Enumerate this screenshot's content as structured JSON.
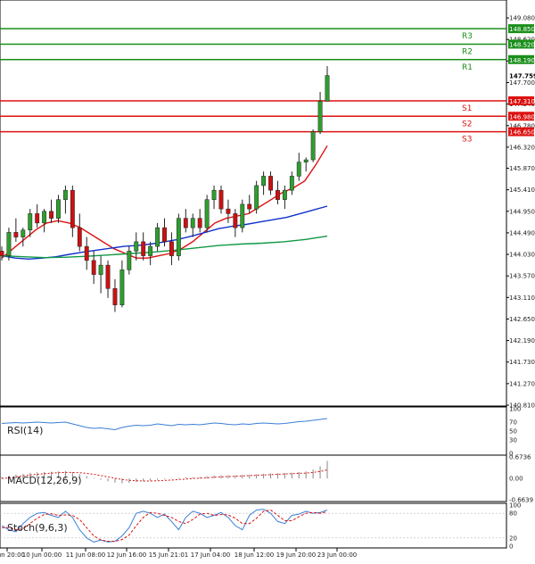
{
  "chart_data": [
    {
      "type": "candlestick",
      "title": "",
      "y_ticks": [
        "149.080",
        "148.620",
        "148.160",
        "147.700",
        "147.240",
        "146.780",
        "146.320",
        "145.870",
        "145.410",
        "144.950",
        "144.490",
        "144.030",
        "143.570",
        "143.110",
        "142.650",
        "142.190",
        "141.730",
        "141.270",
        "140.810"
      ],
      "ylim": [
        140.81,
        149.31
      ],
      "x_ticks": [
        "9 Jun 20:00",
        "10 Jun 00:00",
        "11 Jun 08:00",
        "12 Jun 16:00",
        "15 Jun 21:01",
        "17 Jun 04:00",
        "18 Jun 12:00",
        "19 Jun 20:00",
        "23 Jun 00:00"
      ],
      "candles": [
        {
          "o": 144.1,
          "h": 144.2,
          "l": 143.9,
          "c": 144.0
        },
        {
          "o": 144.0,
          "h": 144.6,
          "l": 143.9,
          "c": 144.5
        },
        {
          "o": 144.5,
          "h": 144.8,
          "l": 144.3,
          "c": 144.4
        },
        {
          "o": 144.4,
          "h": 144.6,
          "l": 144.2,
          "c": 144.55
        },
        {
          "o": 144.55,
          "h": 145.0,
          "l": 144.4,
          "c": 144.9
        },
        {
          "o": 144.9,
          "h": 145.1,
          "l": 144.6,
          "c": 144.7
        },
        {
          "o": 144.7,
          "h": 145.0,
          "l": 144.5,
          "c": 144.95
        },
        {
          "o": 144.95,
          "h": 145.2,
          "l": 144.7,
          "c": 144.8
        },
        {
          "o": 144.8,
          "h": 145.3,
          "l": 144.7,
          "c": 145.2
        },
        {
          "o": 145.2,
          "h": 145.5,
          "l": 144.9,
          "c": 145.4
        },
        {
          "o": 145.4,
          "h": 145.5,
          "l": 144.4,
          "c": 144.6
        },
        {
          "o": 144.6,
          "h": 144.9,
          "l": 144.1,
          "c": 144.2
        },
        {
          "o": 144.2,
          "h": 144.4,
          "l": 143.7,
          "c": 143.9
        },
        {
          "o": 143.9,
          "h": 144.1,
          "l": 143.4,
          "c": 143.6
        },
        {
          "o": 143.6,
          "h": 144.0,
          "l": 143.2,
          "c": 143.8
        },
        {
          "o": 143.8,
          "h": 143.9,
          "l": 143.1,
          "c": 143.3
        },
        {
          "o": 143.3,
          "h": 143.5,
          "l": 142.8,
          "c": 142.95
        },
        {
          "o": 142.95,
          "h": 143.9,
          "l": 142.9,
          "c": 143.7
        },
        {
          "o": 143.7,
          "h": 144.2,
          "l": 143.6,
          "c": 144.1
        },
        {
          "o": 144.1,
          "h": 144.5,
          "l": 143.9,
          "c": 144.3
        },
        {
          "o": 144.3,
          "h": 144.5,
          "l": 143.9,
          "c": 144.0
        },
        {
          "o": 144.0,
          "h": 144.3,
          "l": 143.8,
          "c": 144.2
        },
        {
          "o": 144.2,
          "h": 144.7,
          "l": 144.1,
          "c": 144.6
        },
        {
          "o": 144.6,
          "h": 144.8,
          "l": 144.2,
          "c": 144.3
        },
        {
          "o": 144.3,
          "h": 144.5,
          "l": 143.8,
          "c": 144.0
        },
        {
          "o": 144.0,
          "h": 144.9,
          "l": 143.9,
          "c": 144.8
        },
        {
          "o": 144.8,
          "h": 145.0,
          "l": 144.5,
          "c": 144.6
        },
        {
          "o": 144.6,
          "h": 144.9,
          "l": 144.4,
          "c": 144.8
        },
        {
          "o": 144.8,
          "h": 145.0,
          "l": 144.5,
          "c": 144.6
        },
        {
          "o": 144.6,
          "h": 145.3,
          "l": 144.5,
          "c": 145.2
        },
        {
          "o": 145.2,
          "h": 145.5,
          "l": 145.0,
          "c": 145.4
        },
        {
          "o": 145.4,
          "h": 145.5,
          "l": 144.9,
          "c": 145.0
        },
        {
          "o": 145.0,
          "h": 145.2,
          "l": 144.7,
          "c": 144.9
        },
        {
          "o": 144.9,
          "h": 145.0,
          "l": 144.4,
          "c": 144.6
        },
        {
          "o": 144.6,
          "h": 145.2,
          "l": 144.5,
          "c": 145.1
        },
        {
          "o": 145.1,
          "h": 145.3,
          "l": 144.9,
          "c": 145.0
        },
        {
          "o": 145.0,
          "h": 145.6,
          "l": 144.9,
          "c": 145.5
        },
        {
          "o": 145.5,
          "h": 145.8,
          "l": 145.3,
          "c": 145.7
        },
        {
          "o": 145.7,
          "h": 145.8,
          "l": 145.3,
          "c": 145.4
        },
        {
          "o": 145.4,
          "h": 145.6,
          "l": 145.1,
          "c": 145.2
        },
        {
          "o": 145.2,
          "h": 145.5,
          "l": 145.0,
          "c": 145.4
        },
        {
          "o": 145.4,
          "h": 145.8,
          "l": 145.3,
          "c": 145.7
        },
        {
          "o": 145.7,
          "h": 146.2,
          "l": 145.6,
          "c": 146.0
        },
        {
          "o": 146.0,
          "h": 146.1,
          "l": 145.8,
          "c": 146.05
        },
        {
          "o": 146.05,
          "h": 146.7,
          "l": 146.0,
          "c": 146.65
        },
        {
          "o": 146.65,
          "h": 147.5,
          "l": 146.6,
          "c": 147.3
        },
        {
          "o": 147.3,
          "h": 148.05,
          "l": 147.3,
          "c": 147.85
        }
      ],
      "moving_averages": [
        {
          "color": "#dd1111",
          "values": [
            143.95,
            144.15,
            144.35,
            144.55,
            144.7,
            144.75,
            144.7,
            144.6,
            144.45,
            144.3,
            144.15,
            144.05,
            143.95,
            143.95,
            144.0,
            144.05,
            144.15,
            144.3,
            144.5,
            144.7,
            144.8,
            144.85,
            144.9,
            145.05,
            145.2,
            145.35,
            145.45,
            145.6,
            145.95,
            146.35
          ]
        },
        {
          "color": "#1133cc",
          "values": [
            144.0,
            143.95,
            143.93,
            143.95,
            143.98,
            144.03,
            144.08,
            144.12,
            144.16,
            144.2,
            144.22,
            144.25,
            144.3,
            144.35,
            144.42,
            144.5,
            144.58,
            144.63,
            144.67,
            144.72,
            144.77,
            144.82,
            144.9,
            144.98,
            145.06
          ]
        },
        {
          "color": "#119944",
          "values": [
            144.0,
            143.98,
            143.96,
            143.97,
            143.99,
            144.02,
            144.05,
            144.08,
            144.12,
            144.17,
            144.22,
            144.25,
            144.27,
            144.3,
            144.35,
            144.42
          ]
        }
      ],
      "levels": [
        {
          "label": "R3",
          "price": "148.850",
          "color": "#1a8f1a"
        },
        {
          "label": "R2",
          "price": "148.520",
          "color": "#1a8f1a"
        },
        {
          "label": "R1",
          "price": "148.190",
          "color": "#1a8f1a"
        },
        {
          "label": "S1",
          "price": "147.310",
          "color": "#dd1111"
        },
        {
          "label": "S2",
          "price": "146.980",
          "color": "#dd1111"
        },
        {
          "label": "S3",
          "price": "146.650",
          "color": "#dd1111"
        }
      ],
      "last_price": "147.759"
    },
    {
      "type": "line",
      "series_label": "RSI(14)",
      "ylim": [
        0,
        100
      ],
      "y_ticks": [
        "100",
        "70",
        "50",
        "30",
        "0"
      ],
      "color": "#3a7fd6",
      "values": [
        67,
        68,
        69,
        68,
        69,
        70,
        69,
        68,
        69,
        70,
        66,
        62,
        58,
        56,
        57,
        55,
        53,
        58,
        61,
        63,
        62,
        63,
        66,
        64,
        62,
        65,
        64,
        65,
        64,
        66,
        68,
        67,
        65,
        64,
        66,
        65,
        67,
        68,
        67,
        66,
        67,
        69,
        71,
        72,
        74,
        76,
        78
      ]
    },
    {
      "type": "bar",
      "series_label": "MACD(12,26,9)",
      "y_ticks": [
        "0.6736",
        "0.00",
        "-0.6639"
      ],
      "ylim": [
        -0.6639,
        0.6736
      ],
      "signal_color": "#dd1111",
      "values": [
        0.05,
        0.08,
        0.12,
        0.14,
        0.17,
        0.19,
        0.2,
        0.21,
        0.22,
        0.23,
        0.2,
        0.14,
        0.08,
        0.02,
        -0.04,
        -0.09,
        -0.13,
        -0.15,
        -0.14,
        -0.11,
        -0.09,
        -0.07,
        -0.04,
        -0.02,
        -0.01,
        0.02,
        0.03,
        0.04,
        0.05,
        0.07,
        0.09,
        0.1,
        0.1,
        0.1,
        0.11,
        0.12,
        0.13,
        0.15,
        0.16,
        0.16,
        0.17,
        0.18,
        0.2,
        0.22,
        0.28,
        0.38,
        0.55
      ],
      "signal": [
        0.0,
        0.02,
        0.05,
        0.08,
        0.11,
        0.13,
        0.15,
        0.17,
        0.18,
        0.19,
        0.19,
        0.18,
        0.16,
        0.13,
        0.09,
        0.05,
        0.01,
        -0.03,
        -0.06,
        -0.07,
        -0.08,
        -0.08,
        -0.07,
        -0.06,
        -0.05,
        -0.03,
        -0.02,
        0.0,
        0.01,
        0.02,
        0.04,
        0.05,
        0.06,
        0.07,
        0.08,
        0.09,
        0.1,
        0.11,
        0.12,
        0.13,
        0.14,
        0.15,
        0.16,
        0.17,
        0.19,
        0.22,
        0.27
      ]
    },
    {
      "type": "line",
      "series_label": "Stoch(9,6,3)",
      "ylim": [
        0,
        100
      ],
      "y_ticks": [
        "100",
        "80",
        "20",
        "0"
      ],
      "k_color": "#3a7fd6",
      "d_color": "#dd1111",
      "k": [
        50,
        40,
        35,
        55,
        70,
        80,
        82,
        75,
        70,
        85,
        70,
        40,
        20,
        10,
        15,
        10,
        12,
        25,
        45,
        80,
        85,
        80,
        70,
        78,
        60,
        40,
        70,
        85,
        80,
        70,
        75,
        82,
        70,
        50,
        40,
        75,
        88,
        90,
        80,
        60,
        55,
        75,
        78,
        85,
        80,
        82,
        88
      ],
      "d": [
        45,
        45,
        40,
        42,
        55,
        68,
        77,
        79,
        75,
        76,
        75,
        65,
        45,
        25,
        15,
        12,
        12,
        16,
        27,
        50,
        70,
        82,
        80,
        75,
        70,
        60,
        55,
        65,
        78,
        80,
        75,
        77,
        76,
        68,
        55,
        55,
        68,
        85,
        88,
        75,
        62,
        62,
        72,
        80,
        82,
        80,
        84
      ]
    }
  ]
}
